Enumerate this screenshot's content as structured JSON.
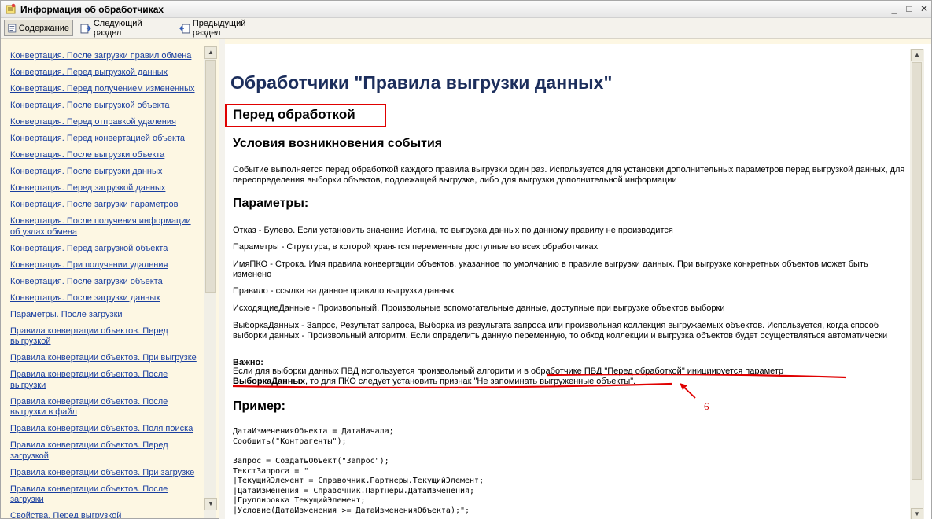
{
  "window": {
    "title": "Информация об обработчиках",
    "controls": {
      "minimize": "_",
      "maximize": "□",
      "close": "✕"
    }
  },
  "toolbar": {
    "contents_label": "Содержание",
    "next_label": "Следующий раздел",
    "prev_label": "Предыдущий раздел"
  },
  "sidebar": {
    "items": [
      "Конвертация. После загрузки правил обмена",
      "Конвертация. Перед выгрузкой данных",
      "Конвертация. Перед получением измененных",
      "Конвертация. После выгрузкой объекта",
      "Конвертация. Перед отправкой удаления",
      "Конвертация. Перед конвертацией объекта",
      "Конвертация. После выгрузки объекта",
      "Конвертация. После выгрузки данных",
      "Конвертация. Перед загрузкой данных",
      "Конвертация. После загрузки параметров",
      "Конвертация. После получения информации об узлах обмена",
      "Конвертация. Перед загрузкой объекта",
      "Конвертация. При получении удаления",
      "Конвертация. После загрузки объекта",
      "Конвертация. После загрузки данных",
      "Параметры. После загрузки",
      "Правила конвертации объектов. Перед выгрузкой",
      "Правила конвертации объектов. При выгрузке",
      "Правила конвертации объектов. После выгрузки",
      "Правила конвертации объектов. После выгрузки в файл",
      "Правила конвертации объектов. Поля поиска",
      "Правила конвертации объектов. Перед загрузкой",
      "Правила конвертации объектов. При загрузке",
      "Правила конвертации объектов. После загрузки",
      "Свойства. Перед выгрузкой"
    ]
  },
  "content": {
    "title": "Обработчики \"Правила выгрузки данных\"",
    "section_title": "Перед обработкой",
    "conditions_heading": "Условия возникновения события",
    "description": "Событие выполняется перед обработкой каждого правила выгрузки один раз. Используется для установки дополнительных параметров перед выгрузкой данных, для переопределения выборки объектов, подлежащей выгрузке, либо для выгрузки дополнительной информации",
    "params_heading": "Параметры:",
    "params": [
      "Отказ - Булево. Если установить значение Истина, то выгрузка данных по данному правилу не производится",
      "Параметры - Структура, в которой хранятся переменные доступные во всех обработчиках",
      "ИмяПКО - Строка. Имя правила конвертации объектов, указанное по умолчанию в правиле выгрузки данных. При выгрузке конкретных объектов может быть изменено",
      "Правило - ссылка на данное правило выгрузки данных",
      "ИсходящиеДанные - Произвольный. Произвольные вспомогательные данные, доступные при выгрузке объектов выборки",
      "ВыборкаДанных - Запрос, Результат запроса, Выборка из результата запроса или произвольная коллекция выгружаемых объектов. Используется, когда способ выборки данных - Произвольный алгоритм. Если определить данную переменную, то обход коллекции и выгрузка объектов будет осуществляться автоматически"
    ],
    "important": {
      "title": "Важно:",
      "line1": "Если для выборки данных ПВД используется произвольный алгоритм и в обработчике ПВД \"Перед обработкой\" инициируется параметр",
      "line2_bold": "ВыборкаДанных",
      "line2_rest": ", то для ПКО следует установить признак \"Не запоминать выгруженные объекты\"."
    },
    "example_heading": "Пример:",
    "code_block_1": "ДатаИзмененияОбъекта = ДатаНачала;\nСообщить(\"Контрагенты\");",
    "code_block_2": "Запрос = СоздатьОбъект(\"Запрос\");\nТекстЗапроса = \"\n|ТекущийЭлемент = Справочник.Партнеры.ТекущийЭлемент;\n|ДатаИзменения = Справочник.Партнеры.ДатаИзменения;\n|Группировка ТекущийЭлемент;\n|Условие(ДатаИзменения >= ДатаИзмененияОбъекта);\";"
  },
  "annotation": {
    "label": "6",
    "color": "#e00000"
  }
}
